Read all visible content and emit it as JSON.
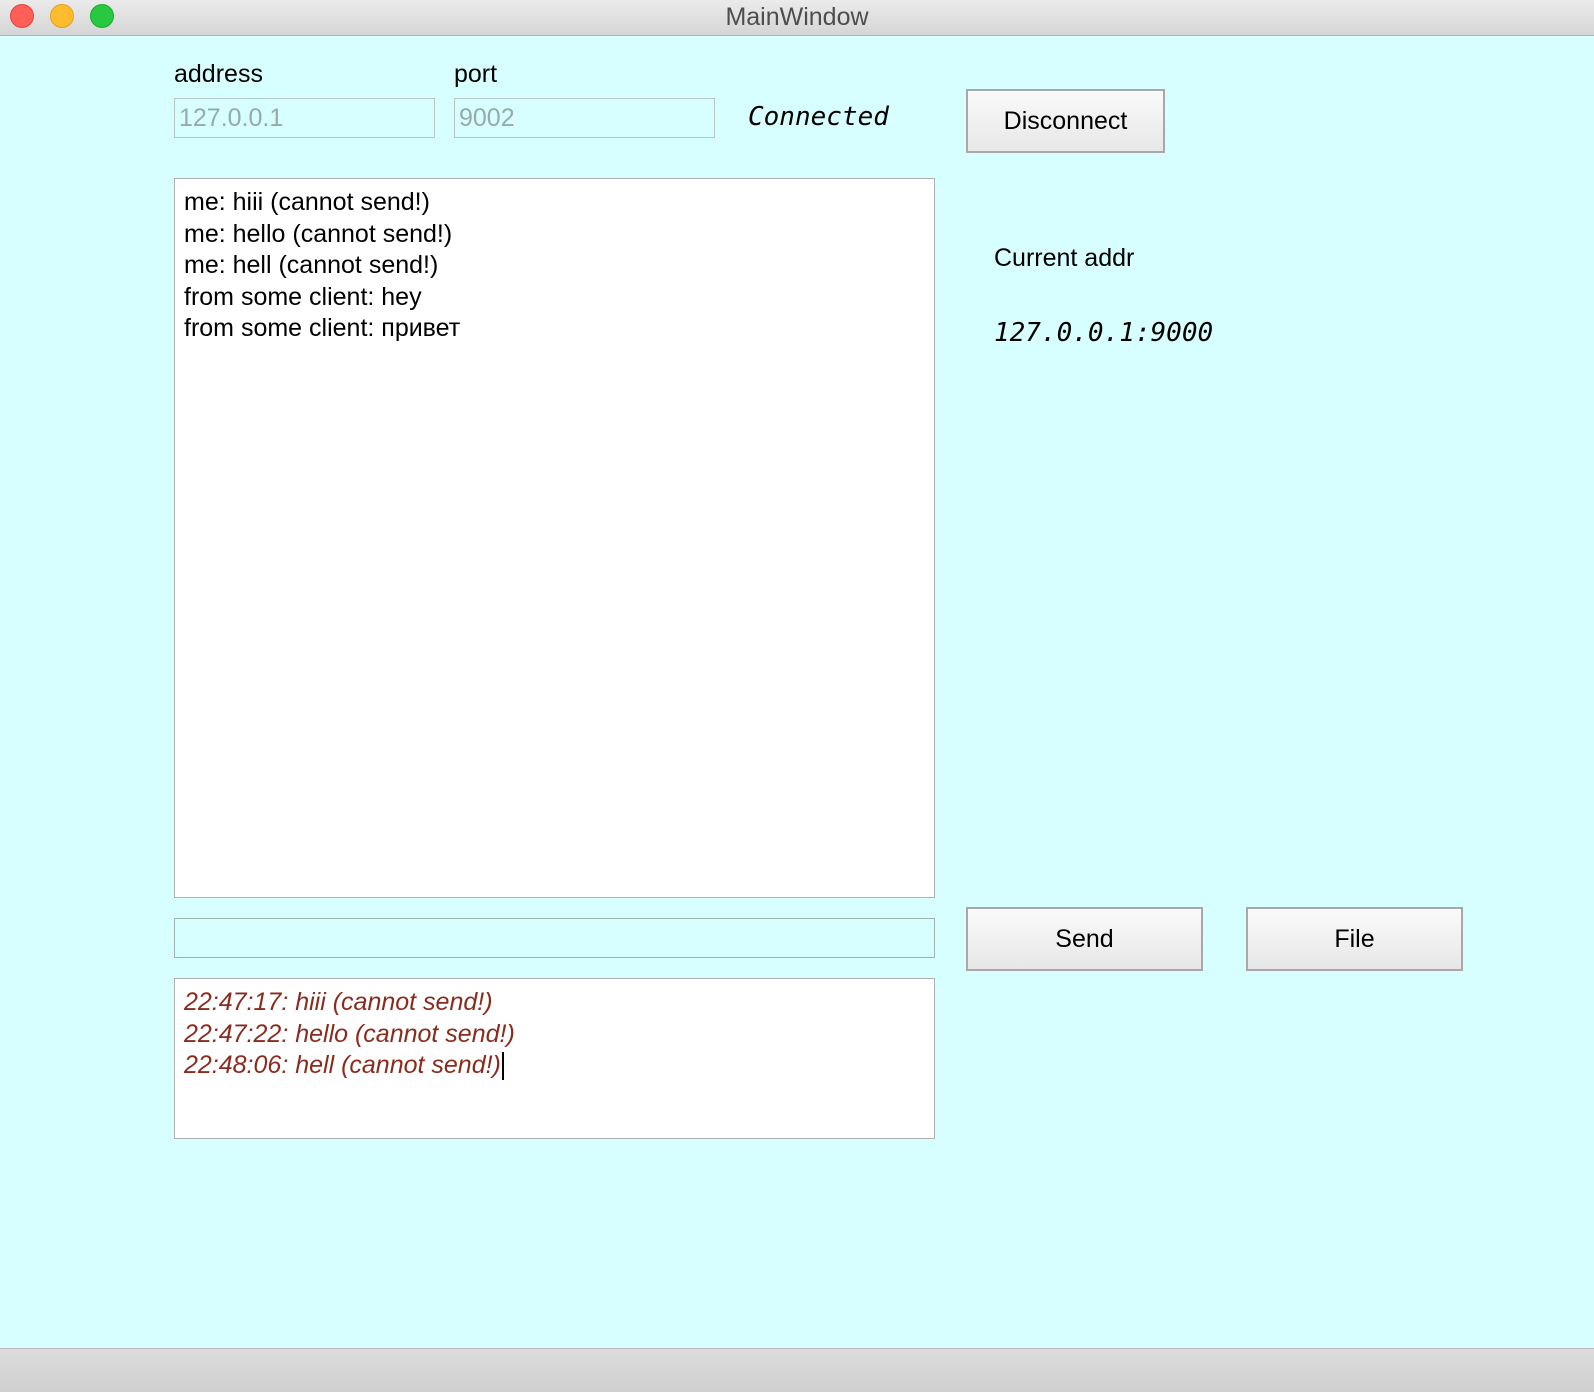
{
  "window": {
    "title": "MainWindow"
  },
  "connection": {
    "address_label": "address",
    "address_value": "127.0.0.1",
    "port_label": "port",
    "port_value": "9002",
    "status_text": "Connected",
    "disconnect_label": "Disconnect"
  },
  "messages": [
    "me: hiii (cannot send!)",
    "me: hello (cannot send!)",
    "me: hell (cannot send!)",
    "from some client: hey",
    "from some client: привет"
  ],
  "compose": {
    "value": "",
    "send_label": "Send",
    "file_label": "File"
  },
  "log": [
    "22:47:17: hiii (cannot send!)",
    "22:47:22: hello (cannot send!)",
    "22:48:06: hell (cannot send!)"
  ],
  "current_addr": {
    "label": "Current addr",
    "value": "127.0.0.1:9000"
  },
  "colors": {
    "background": "#d8ffff",
    "log_text": "#8a2b1e"
  }
}
